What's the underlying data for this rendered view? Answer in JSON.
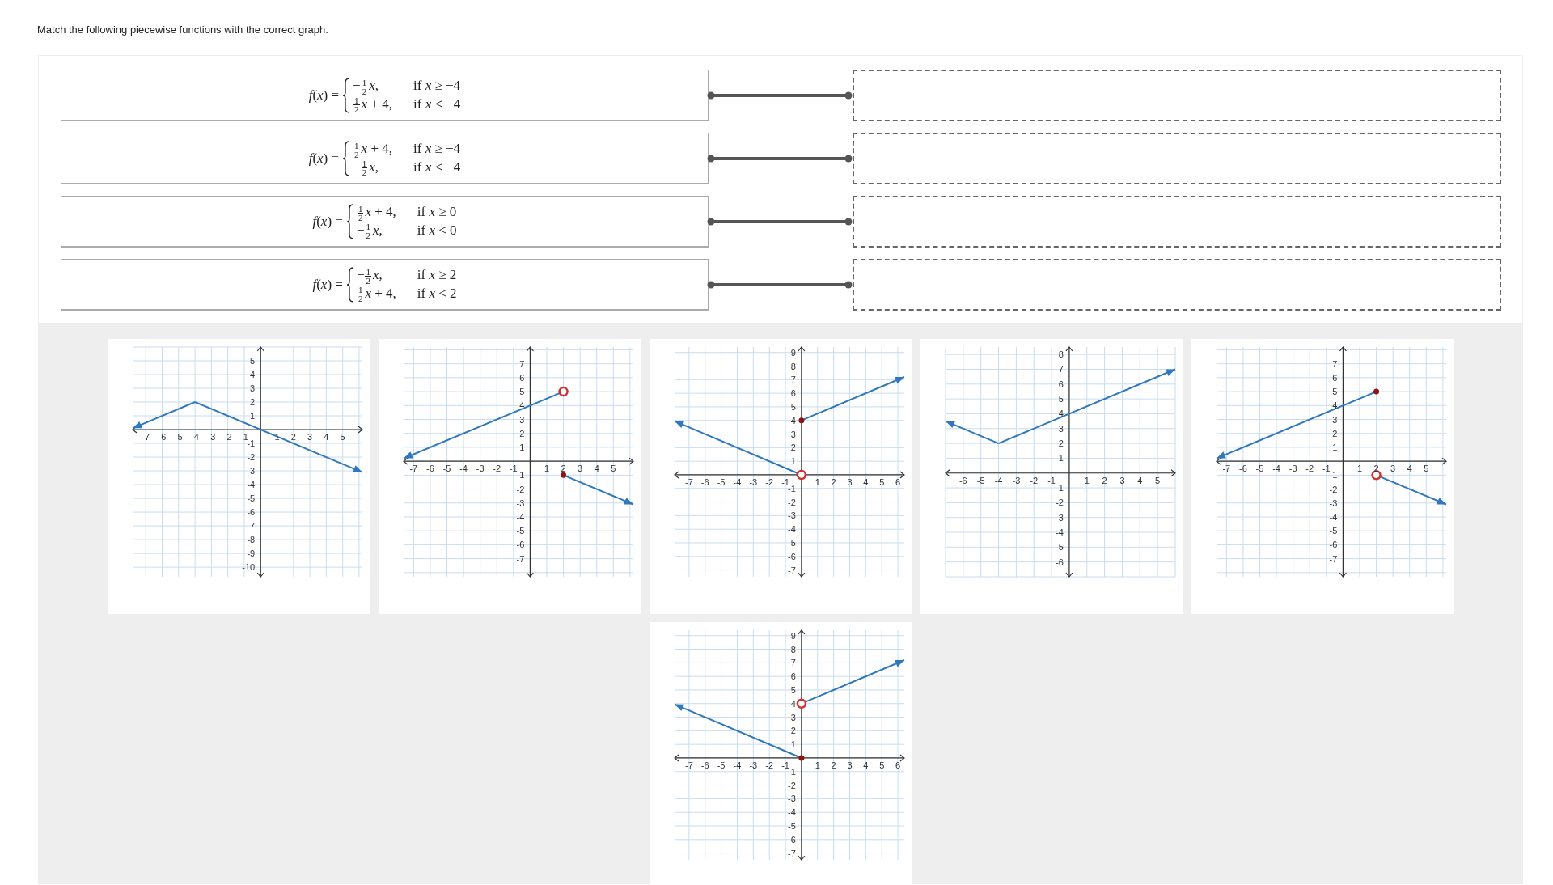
{
  "instruction": "Match the following piecewise functions with the correct graph.",
  "matches": [
    {
      "formula": {
        "lhs": "*f*(*x*) =",
        "cases": [
          {
            "sign": "−",
            "frac": [
              "1",
              "2"
            ],
            "tail": "*x*,",
            "cond": "if *x* ≥ −4"
          },
          {
            "frac": [
              "1",
              "2"
            ],
            "tail": "*x* + 4,",
            "cond": "if *x* < −4"
          }
        ]
      }
    },
    {
      "formula": {
        "lhs": "*f*(*x*) =",
        "cases": [
          {
            "frac": [
              "1",
              "2"
            ],
            "tail": "*x* + 4,",
            "cond": "if *x* ≥ −4"
          },
          {
            "sign": "−",
            "frac": [
              "1",
              "2"
            ],
            "tail": "*x*,",
            "cond": "if *x* < −4"
          }
        ]
      }
    },
    {
      "formula": {
        "lhs": "*f*(*x*) =",
        "cases": [
          {
            "frac": [
              "1",
              "2"
            ],
            "tail": "*x* + 4,",
            "cond": "if *x* ≥ 0"
          },
          {
            "sign": "−",
            "frac": [
              "1",
              "2"
            ],
            "tail": "*x*,",
            "cond": "if *x* < 0"
          }
        ]
      }
    },
    {
      "formula": {
        "lhs": "*f*(*x*) =",
        "cases": [
          {
            "sign": "−",
            "frac": [
              "1",
              "2"
            ],
            "tail": "*x*,",
            "cond": "if *x* ≥ 2"
          },
          {
            "frac": [
              "1",
              "2"
            ],
            "tail": "*x* + 4,",
            "cond": "if *x* < 2"
          }
        ]
      }
    }
  ],
  "graphs": [
    {
      "chart_data": {
        "type": "line",
        "grid": true,
        "x": [
          -7.8,
          -4,
          6.2
        ],
        "series": [
          {
            "color": "#2f78bd",
            "values": [
              0.1,
              2,
              null
            ]
          },
          {
            "color": "#2f78bd",
            "values": [
              null,
              2,
              -3.1
            ]
          }
        ],
        "xlim": [
          -7.8,
          6.2
        ],
        "ylim": [
          -10.7,
          6
        ],
        "xticks": [
          -7,
          -6,
          -5,
          -4,
          -3,
          -2,
          -1,
          1,
          2,
          3,
          4,
          5
        ],
        "yticks": [
          5,
          4,
          3,
          2,
          1,
          -1,
          -2,
          -3,
          -4,
          -5,
          -6,
          -7,
          -8,
          -9,
          -10
        ]
      }
    },
    {
      "endpoints": [
        {
          "filled": false
        },
        {
          "filled": true
        }
      ],
      "chart_data": {
        "type": "line",
        "grid": true,
        "x": [
          -7.6,
          2,
          6.2
        ],
        "series": [
          {
            "color": "#2f78bd",
            "values": [
              0.2,
              5,
              null
            ]
          },
          {
            "color": "#2f78bd",
            "values": [
              null,
              -1,
              -3.1
            ]
          }
        ],
        "xlim": [
          -7.6,
          6.2
        ],
        "ylim": [
          -8.3,
          8.2
        ],
        "xticks": [
          -7,
          -6,
          -5,
          -4,
          -3,
          -2,
          -1,
          1,
          2,
          3,
          4,
          5
        ],
        "yticks": [
          7,
          6,
          5,
          4,
          3,
          2,
          1,
          -1,
          -2,
          -3,
          -4,
          -5,
          -6,
          -7
        ]
      }
    },
    {
      "endpoints": [
        {
          "filled": false
        },
        {
          "filled": true
        }
      ],
      "chart_data": {
        "type": "line",
        "grid": true,
        "x": [
          -7.9,
          0,
          6.4
        ],
        "series": [
          {
            "color": "#2f78bd",
            "values": [
              3.95,
              0,
              null
            ]
          },
          {
            "color": "#2f78bd",
            "values": [
              null,
              4,
              7.2
            ]
          }
        ],
        "xlim": [
          -7.9,
          6.4
        ],
        "ylim": [
          -7.5,
          9.4
        ],
        "xticks": [
          -7,
          -6,
          -5,
          -4,
          -3,
          -2,
          -1,
          1,
          2,
          3,
          4,
          5,
          6
        ],
        "yticks": [
          9,
          8,
          7,
          6,
          5,
          4,
          3,
          2,
          1,
          -1,
          -2,
          -3,
          -4,
          -5,
          -6,
          -7
        ]
      }
    },
    {
      "chart_data": {
        "type": "line",
        "grid": true,
        "x": [
          -7,
          -4,
          6
        ],
        "series": [
          {
            "color": "#2f78bd",
            "values": [
              3.5,
              2,
              null
            ]
          },
          {
            "color": "#2f78bd",
            "values": [
              null,
              2,
              7
            ]
          }
        ],
        "xlim": [
          -7,
          6
        ],
        "ylim": [
          -7,
          8.5
        ],
        "xticks": [
          -6,
          -5,
          -4,
          -3,
          -2,
          -1,
          1,
          2,
          3,
          4,
          5
        ],
        "yticks": [
          8,
          7,
          6,
          5,
          4,
          3,
          2,
          1,
          -1,
          -2,
          -3,
          -4,
          -5,
          -6
        ]
      }
    },
    {
      "endpoints": [
        {
          "filled": true
        },
        {
          "filled": false
        }
      ],
      "chart_data": {
        "type": "line",
        "grid": true,
        "x": [
          -7.6,
          2,
          6.2
        ],
        "series": [
          {
            "color": "#2f78bd",
            "values": [
              0.2,
              5,
              null
            ]
          },
          {
            "color": "#2f78bd",
            "values": [
              null,
              -1,
              -3.1
            ]
          }
        ],
        "xlim": [
          -7.6,
          6.2
        ],
        "ylim": [
          -8.3,
          8.2
        ],
        "xticks": [
          -7,
          -6,
          -5,
          -4,
          -3,
          -2,
          -1,
          1,
          2,
          3,
          4,
          5
        ],
        "yticks": [
          7,
          6,
          5,
          4,
          3,
          2,
          1,
          -1,
          -2,
          -3,
          -4,
          -5,
          -6,
          -7
        ]
      }
    },
    {
      "endpoints": [
        {
          "filled": true
        },
        {
          "filled": false
        }
      ],
      "chart_data": {
        "type": "line",
        "grid": true,
        "x": [
          -7.9,
          0,
          6.4
        ],
        "series": [
          {
            "color": "#2f78bd",
            "values": [
              3.95,
              0,
              null
            ]
          },
          {
            "color": "#2f78bd",
            "values": [
              null,
              4,
              7.2
            ]
          }
        ],
        "xlim": [
          -7.9,
          6.4
        ],
        "ylim": [
          -7.5,
          9.4
        ],
        "xticks": [
          -7,
          -6,
          -5,
          -4,
          -3,
          -2,
          -1,
          1,
          2,
          3,
          4,
          5,
          6
        ],
        "yticks": [
          9,
          8,
          7,
          6,
          5,
          4,
          3,
          2,
          1,
          -1,
          -2,
          -3,
          -4,
          -5,
          -6,
          -7
        ]
      }
    }
  ]
}
